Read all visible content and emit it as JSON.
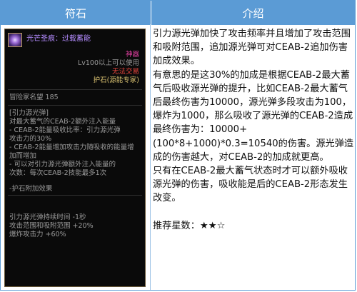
{
  "header": {
    "left": "符石",
    "right": "介绍"
  },
  "item": {
    "name": "光芒圣痕：过载蓄能",
    "rarity": "神器",
    "level_req": "Lv100以上可以使用",
    "trade": "无法交易",
    "type": "护石(源能专家)",
    "reputation": "冒险家名望 185",
    "skill_title": "[引力源光弹]",
    "effect_lines": [
      "对最大蓄气的CEAB-2额外注入能量",
      "- CEAB-2能量吸收比率：引力源光弹",
      "攻击力的30%",
      "- CEAB-2能量增加攻击力随吸收的能量增",
      "加而增加",
      "- 可以对引力源光弹额外注入能量的",
      "次数：每次CEAB-2技能最多1次"
    ],
    "bonus_title": "-护石附加效果",
    "bonus_lines": [
      "引力源光弹持续时间 -1秒",
      "攻击范围和吸附范围 +20%",
      "爆炸攻击力 +60%"
    ],
    "colors": {
      "name": "#b48cff",
      "rarity": "#e040a0",
      "trade": "#e8453c",
      "type": "#d8c070",
      "text": "#9a9a9a"
    }
  },
  "description": {
    "para1": "引力源光弹加快了攻击频率并且增加了攻击范围和吸附范围，追加源光弹可对CEAB-2追加伤害加成效果。",
    "para2": "有意思的是这30%的加成是根据CEAB-2最大蓄气后吸收源光弹的提升，比如CEAB-2最大蓄气后最终伤害为10000，源光弹多段攻击为100，爆炸为1000，那么吸收了源光弹的CEAB-2造成最终伤害为：10000+(100*8+1000)*0.3=10540的伤害。源光弹造成的伤害越大，对CEAB-2的加成就更高。",
    "para3": "只有在CEAB-2最大蓄气状态时才可以额外吸收源光弹的伤害，吸收能是后的CEAB-2形态发生改变。",
    "rating": "推荐星数：★★☆"
  }
}
